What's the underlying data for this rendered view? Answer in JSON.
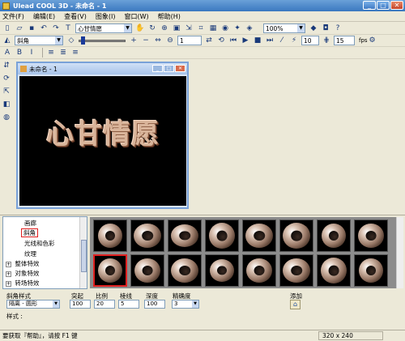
{
  "window": {
    "title": "Ulead COOL 3D - 未命名 - 1"
  },
  "menu": [
    "文件(F)",
    "编辑(E)",
    "查看(V)",
    "图象(I)",
    "窗口(W)",
    "帮助(H)"
  ],
  "toolbar1": {
    "text_combo": "心甘情愿",
    "zoom_combo": "100%"
  },
  "toolbar2": {
    "effect_combo": "斜角",
    "frame_value": "1",
    "speed_value": "10",
    "fps_value": "15",
    "fps_label": "fps"
  },
  "document": {
    "title": "未命名 - 1",
    "canvas_text": "心甘情愿"
  },
  "tree": {
    "items": [
      {
        "label": "画廊"
      },
      {
        "label": "斜角"
      },
      {
        "label": "光线和色彩"
      },
      {
        "label": "纹理"
      },
      {
        "label": "整体特效"
      },
      {
        "label": "对象特效"
      },
      {
        "label": "转场特效"
      }
    ]
  },
  "properties": {
    "style_label": "斜角样式",
    "style_value": "隔离 - 圆形",
    "protrude_label": "突起",
    "protrude_value": "100",
    "ratio_label": "比例",
    "ratio_value": "20",
    "edge_label": "棱线",
    "edge_value": "5",
    "depth_label": "深度",
    "depth_value": "100",
    "precision_label": "精确度",
    "precision_value": "3",
    "add_label": "添加",
    "style_footer_label": "样式 :"
  },
  "status": {
    "help_text": "要获取『帮助』，请按 F1 键",
    "dimensions": "320 x 240"
  }
}
